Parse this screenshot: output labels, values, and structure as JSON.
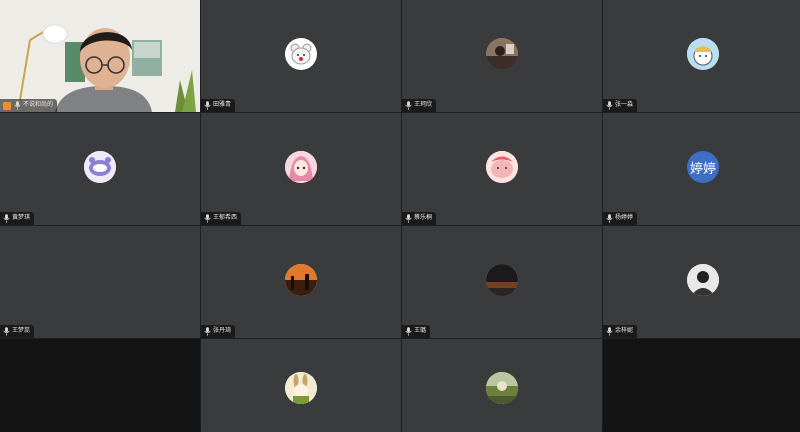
{
  "participants": [
    {
      "name": "不说和尚的",
      "type": "video",
      "host": true
    },
    {
      "name": "田雅青",
      "type": "avatar",
      "avatar_icon": "bear-icon"
    },
    {
      "name": "王珂欣",
      "type": "avatar",
      "avatar_icon": "photo-avatar-icon"
    },
    {
      "name": "张一淼",
      "type": "avatar",
      "avatar_icon": "cartoon-avatar-icon"
    },
    {
      "name": "黄梦琪",
      "type": "avatar",
      "avatar_icon": "cartoon-cat-icon"
    },
    {
      "name": "王郁希西",
      "type": "avatar",
      "avatar_icon": "anime-girl-icon"
    },
    {
      "name": "蔡乐桐",
      "type": "avatar",
      "avatar_icon": "pink-pig-icon"
    },
    {
      "name": "杨婷婷",
      "type": "text",
      "avatar_text": "婷婷"
    },
    {
      "name": "王梦蕊",
      "type": "none"
    },
    {
      "name": "张丹琦",
      "type": "avatar",
      "avatar_icon": "sunset-photo-icon"
    },
    {
      "name": "王璐",
      "type": "avatar",
      "avatar_icon": "night-photo-icon"
    },
    {
      "name": "余梓妮",
      "type": "avatar",
      "avatar_icon": "bw-photo-icon"
    },
    {
      "name": "",
      "type": "empty"
    },
    {
      "name": "",
      "type": "avatar-noname",
      "avatar_icon": "bunny-illustration-icon"
    },
    {
      "name": "",
      "type": "avatar-noname",
      "avatar_icon": "landscape-photo-icon"
    },
    {
      "name": "",
      "type": "empty"
    }
  ],
  "colors": {
    "tile_bg": "#3a3b3d",
    "empty_bg": "#141414",
    "active_speaker_border": "#2dbd5d",
    "host_badge": "#f08c2a"
  }
}
